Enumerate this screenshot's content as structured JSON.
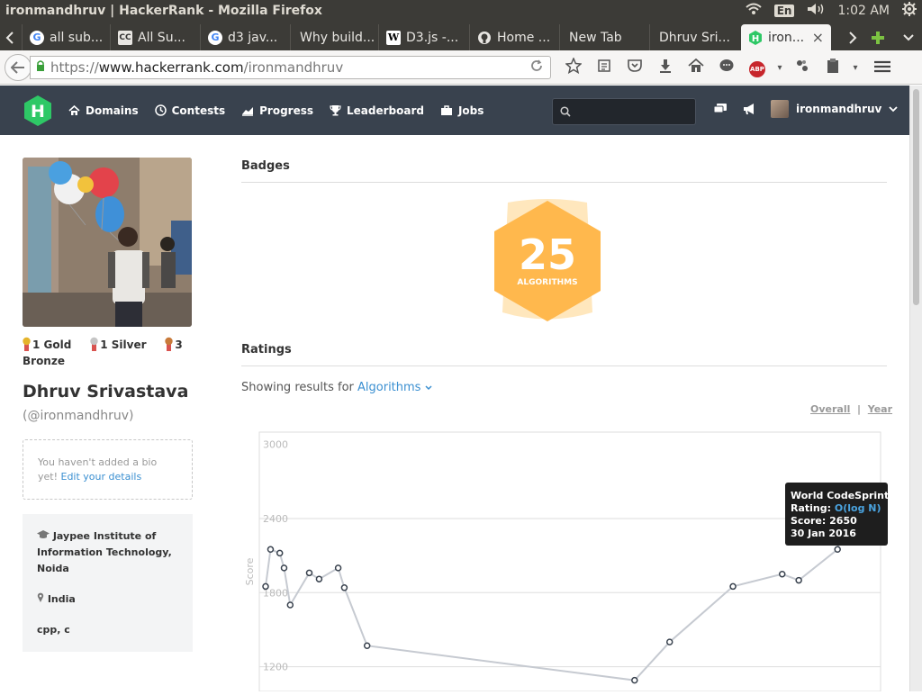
{
  "os": {
    "window_title": "ironmandhruv | HackerRank - Mozilla Firefox",
    "lang": "En",
    "clock": "1:02 AM"
  },
  "tabs": [
    {
      "label": "all sub...",
      "favicon": "google-icon"
    },
    {
      "label": "All Su...",
      "favicon": "cc-icon"
    },
    {
      "label": "d3 jav...",
      "favicon": "google-icon"
    },
    {
      "label": "Why build...",
      "favicon": "none"
    },
    {
      "label": "D3.js -...",
      "favicon": "wikipedia-icon"
    },
    {
      "label": "Home ...",
      "favicon": "github-icon"
    },
    {
      "label": "New Tab",
      "favicon": "none"
    },
    {
      "label": "Dhruv Sri...",
      "favicon": "none"
    },
    {
      "label": "iron...",
      "favicon": "hackerrank-icon",
      "active": true
    }
  ],
  "url": {
    "scheme": "https://",
    "host": "www.hackerrank.com",
    "path": "/ironmandhruv"
  },
  "header": {
    "nav": [
      {
        "label": "Domains",
        "icon": "home-icon"
      },
      {
        "label": "Contests",
        "icon": "clock-icon"
      },
      {
        "label": "Progress",
        "icon": "chart-icon"
      },
      {
        "label": "Leaderboard",
        "icon": "trophy-icon"
      },
      {
        "label": "Jobs",
        "icon": "briefcase-icon"
      }
    ],
    "username": "ironmandhruv"
  },
  "profile": {
    "medals": [
      {
        "text": "1 Gold",
        "color": "#e5b42b"
      },
      {
        "text": "1 Silver",
        "color": "#c5c5c5"
      },
      {
        "text": "3 Bronze",
        "color": "#c87a3a"
      }
    ],
    "name": "Dhruv Srivastava",
    "handle": "(@ironmandhruv)",
    "bio_text": "You haven't added a bio yet!",
    "bio_link": "Edit your details",
    "institute": "Jaypee Institute of Information Technology, Noida",
    "location": "India",
    "languages": "cpp, c"
  },
  "badges": {
    "title": "Badges",
    "items": [
      {
        "number": "25",
        "label": "ALGORITHMS",
        "color": "#ffb84d"
      }
    ]
  },
  "ratings": {
    "title": "Ratings",
    "showing_prefix": "Showing results for",
    "domain": "Algorithms",
    "toggle_overall": "Overall",
    "toggle_year": "Year"
  },
  "chart_data": {
    "type": "line",
    "ylabel": "Score",
    "y_ticks": [
      3000,
      2400,
      1800,
      1200
    ],
    "ylim": [
      1000,
      3100
    ],
    "series": [
      {
        "values": [
          1850,
          2150,
          2120,
          2000,
          1700,
          1960,
          1910,
          2000,
          1840,
          1370,
          1090,
          1400,
          1850,
          1950,
          1900,
          2150,
          2650
        ]
      }
    ],
    "point_x": [
      0,
      0.008,
      0.023,
      0.03,
      0.04,
      0.071,
      0.087,
      0.118,
      0.128,
      0.165,
      0.6,
      0.657,
      0.76,
      0.84,
      0.867,
      0.93,
      0.955
    ],
    "tooltip": {
      "contest": "World CodeSprint",
      "rating_label": "Rating:",
      "rating_value": "O(log N)",
      "score_label": "Score:",
      "score_value": "2650",
      "date": "30 Jan 2016"
    },
    "grid": true,
    "colors": {
      "line": "#c6cad1",
      "point_stroke": "#39424e",
      "tooltip_bg": "#1e1e1e",
      "tooltip_link": "#4aa3df"
    }
  }
}
